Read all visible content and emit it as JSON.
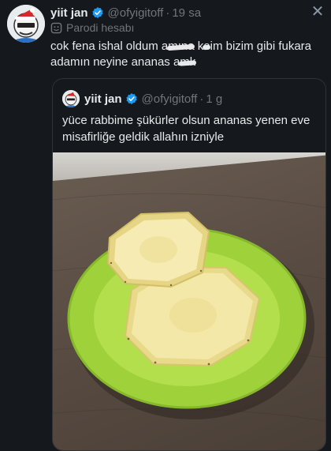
{
  "tweet": {
    "display_name": "yiit jan",
    "handle": "@ofyigitoff",
    "separator": "·",
    "time": "19 sa",
    "parody_label": "Parodi hesabı",
    "text_part1": "cok fena ishal oldum a",
    "text_censor1": "mına",
    "text_part2": " k",
    "text_censor2": "o",
    "text_part3": "im bizim gibi fukara adamın neyine ananas a",
    "text_censor3": "mk"
  },
  "quoted": {
    "display_name": "yiit jan",
    "handle": "@ofyigitoff",
    "separator": "·",
    "time": "1 g",
    "text": "yüce rabbime şükürler olsun ananas yenen eve misafirliğe geldik allahın izniyle"
  },
  "icons": {
    "verified": "verified-badge-icon",
    "close": "close-icon",
    "parody": "parody-account-icon"
  },
  "colors": {
    "background": "#15191e",
    "verified": "#1d9bf0",
    "secondary_text": "#71767b",
    "plate": "#a7d83b",
    "pineapple": "#f1e6a3"
  },
  "close_glyph": "✕"
}
